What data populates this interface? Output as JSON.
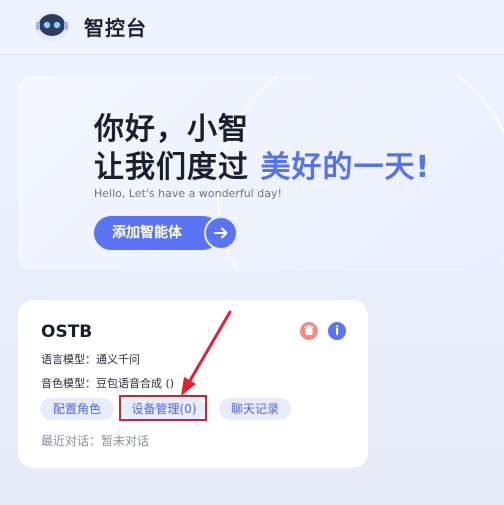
{
  "header": {
    "app_title": "智控台",
    "logo_icon": "robot-logo-icon"
  },
  "hero": {
    "greeting_line1": "你好，小智",
    "greeting_line2_prefix": "让我们度过",
    "greeting_line2_accent": "美好的一天!",
    "subtitle": "Hello, Let's have a wonderful day!",
    "add_agent_label": "添加智能体",
    "arrow_icon": "arrow-right-icon"
  },
  "agent_card": {
    "name": "OSTB",
    "delete_icon": "trash-icon",
    "info_icon": "info-icon",
    "info_glyph": "i",
    "language_model": "语言模型：通义千问",
    "voice_model": "音色模型：豆包语音合成 ()",
    "config_role_label": "配置角色",
    "device_manage_label": "设备管理(0)",
    "chat_log_label": "聊天记录",
    "recent_chat": "最近对话：暂未对话"
  },
  "colors": {
    "accent": "#5b74f4",
    "highlight": "#d6202a",
    "danger": "#f08c82"
  }
}
